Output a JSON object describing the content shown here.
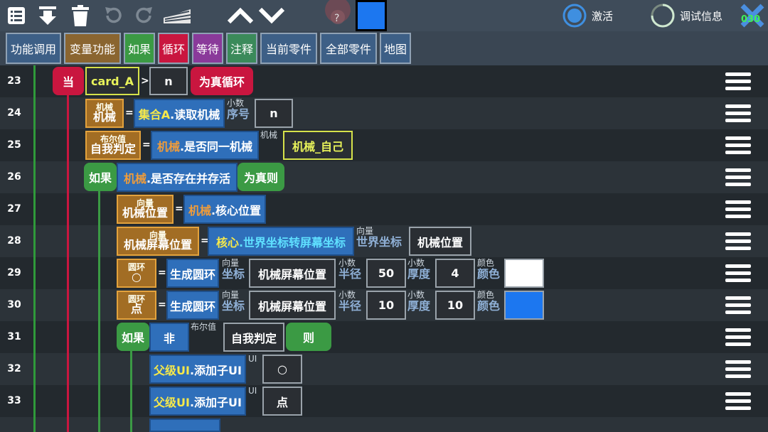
{
  "toolbar": {
    "icons": [
      "list-icon",
      "download-icon",
      "trash-icon",
      "undo-icon",
      "redo-icon",
      "keyboard-icon",
      "chevron-up-icon",
      "chevron-down-icon"
    ],
    "activate_label": "激活",
    "debug_label": "调试信息",
    "close_badge": "030",
    "selected_color": "#1c77f0"
  },
  "tabs": [
    {
      "label": "功能调用",
      "color": "#3d5f86"
    },
    {
      "label": "变量功能",
      "color": "#8a6530"
    },
    {
      "label": "如果",
      "color": "#3b9a44"
    },
    {
      "label": "循环",
      "color": "#c9163f"
    },
    {
      "label": "等待",
      "color": "#8a3a9a"
    },
    {
      "label": "注释",
      "color": "#3b8a5a"
    },
    {
      "label": "当前零件",
      "color": "#3d5f86"
    },
    {
      "label": "全部零件",
      "color": "#3d5f86"
    },
    {
      "label": "地图",
      "color": "#3d5f86"
    }
  ],
  "rows": {
    "numbers": [
      "23",
      "24",
      "25",
      "26",
      "27",
      "28",
      "29",
      "30",
      "31",
      "32",
      "33"
    ],
    "r23": {
      "kw": "当",
      "lit": "card_A",
      "op": ">",
      "val": "n",
      "end": "为真循环"
    },
    "r24": {
      "vtype": "机械",
      "vname": "机械",
      "eq": "=",
      "fn_prefix": "集合A",
      "fn": ".读取机械",
      "ptype": "小数",
      "pname": "序号",
      "val": "n"
    },
    "r25": {
      "vtype": "布尔值",
      "vname": "自我判定",
      "eq": "=",
      "fn_prefix": "机械",
      "fn": ".是否同一机械",
      "ptype": "机械",
      "lit": "机械_自己"
    },
    "r26": {
      "kw": "如果",
      "fn_prefix": "机械",
      "fn": ".是否存在并存活",
      "end": "为真则"
    },
    "r27": {
      "vtype": "向量",
      "vname": "机械位置",
      "eq": "=",
      "fn_prefix": "机械",
      "fn": ".核心位置"
    },
    "r28": {
      "vtype": "向量",
      "vname": "机械屏幕位置",
      "eq": "=",
      "fn_prefix": "核心",
      "fn": ".世界坐标转屏幕坐标",
      "ptype": "向量",
      "pname": "世界坐标",
      "val": "机械位置"
    },
    "r29": {
      "vtype": "圆环",
      "vname": "○",
      "eq": "=",
      "fn": "生成圆环",
      "p1t": "向量",
      "p1n": "坐标",
      "v1": "机械屏幕位置",
      "p2t": "小数",
      "p2n": "半径",
      "v2": "50",
      "p3t": "小数",
      "p3n": "厚度",
      "v3": "4",
      "p4t": "颜色",
      "p4n": "颜色",
      "color": "#ffffff"
    },
    "r30": {
      "vtype": "圆环",
      "vname": "点",
      "eq": "=",
      "fn": "生成圆环",
      "p1t": "向量",
      "p1n": "坐标",
      "v1": "机械屏幕位置",
      "p2t": "小数",
      "p2n": "半径",
      "v2": "10",
      "p3t": "小数",
      "p3n": "厚度",
      "v3": "10",
      "p4t": "颜色",
      "p4n": "颜色",
      "color": "#1c77f0"
    },
    "r31": {
      "kw": "如果",
      "not": "非",
      "ptype": "布尔值",
      "val": "自我判定",
      "end": "则"
    },
    "r32": {
      "fn_prefix": "父级UI",
      "fn": ".添加子UI",
      "ptype": "UI",
      "val": "○"
    },
    "r33": {
      "fn_prefix": "父级UI",
      "fn": ".添加子UI",
      "ptype": "UI",
      "val": "点"
    }
  }
}
